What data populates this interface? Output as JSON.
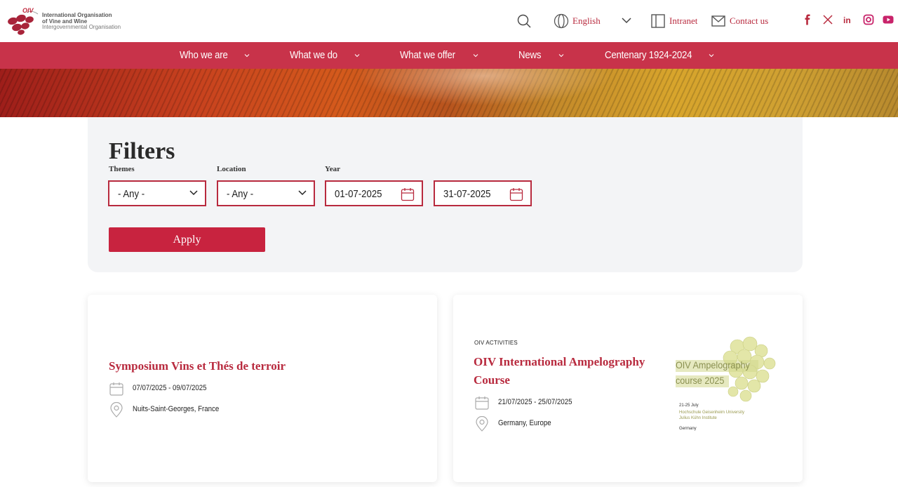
{
  "header": {
    "logo": {
      "tag": "OIV",
      "line1": "International Organisation",
      "line2": "of Vine and Wine",
      "line3": "Intergovernmental Organisation"
    },
    "search_icon": "search-icon",
    "language": "English",
    "intranet": "Intranet",
    "contact": "Contact us",
    "social": [
      "facebook-icon",
      "x-icon",
      "linkedin-icon",
      "instagram-icon",
      "youtube-icon"
    ],
    "accent_color": "#c8334a"
  },
  "nav": {
    "items": [
      {
        "label": "Who we are"
      },
      {
        "label": "What we do"
      },
      {
        "label": "What we offer"
      },
      {
        "label": "News"
      },
      {
        "label": "Centenary 1924-2024"
      }
    ]
  },
  "filters": {
    "title": "Filters",
    "themes_label": "Themes",
    "themes_value": "- Any -",
    "location_label": "Location",
    "location_value": "- Any -",
    "year_label": "Year",
    "date_from": "01-07-2025",
    "date_to": "31-07-2025",
    "apply_label": "Apply"
  },
  "events": [
    {
      "category": "",
      "title": "Symposium Vins et Thés de terroir",
      "dates": "07/07/2025 - 09/07/2025",
      "location": "Nuits-Saint-Georges, France"
    },
    {
      "category": "OIV ACTIVITIES",
      "title_line1": "OIV International Ampelography",
      "title_line2": "Course",
      "dates": "21/07/2025 - 25/07/2025",
      "location": "Germany, Europe",
      "poster": {
        "line1": "OIV Ampelography",
        "line2": "course 2025",
        "dates": "21-25 July",
        "uni1": "Hochschule Geisenheim University",
        "uni2": "Julius Kühn Institute",
        "country": "Germany"
      }
    }
  ]
}
